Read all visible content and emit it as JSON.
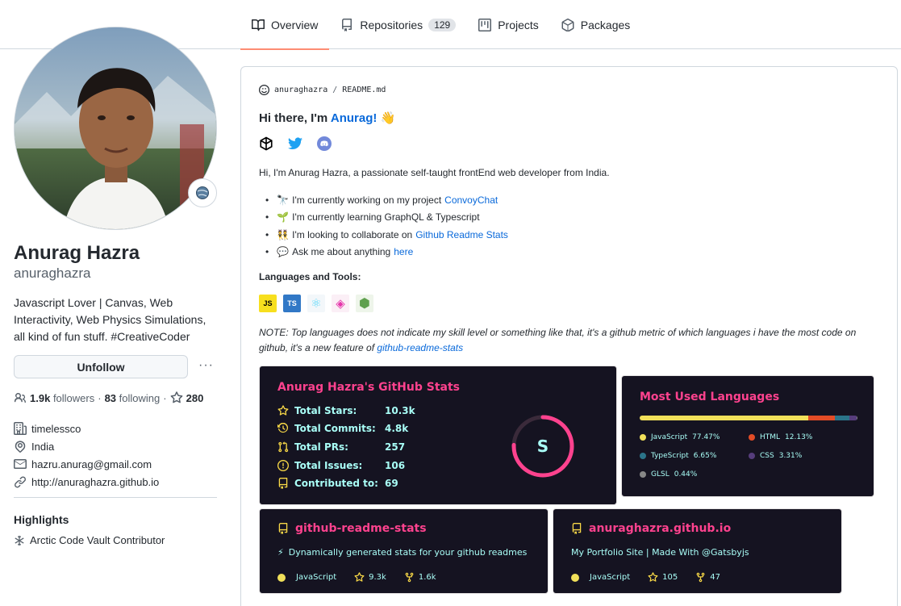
{
  "tabs": [
    {
      "label": "Overview",
      "icon": "book-icon",
      "active": true
    },
    {
      "label": "Repositories",
      "icon": "repo-icon",
      "count": "129"
    },
    {
      "label": "Projects",
      "icon": "project-icon"
    },
    {
      "label": "Packages",
      "icon": "package-icon"
    }
  ],
  "profile": {
    "name": "Anurag Hazra",
    "login": "anuraghazra",
    "bio": "Javascript Lover | Canvas, Web Interactivity, Web Physics Simulations, all kind of fun stuff. #CreativeCoder",
    "unfollow_label": "Unfollow",
    "more_label": "···",
    "followers_count": "1.9k",
    "followers_label": "followers",
    "following_count": "83",
    "following_label": "following",
    "stars_count": "280",
    "company": "timelessco",
    "location": "India",
    "email": "hazru.anurag@gmail.com",
    "website": "http://anuraghazra.github.io",
    "highlights_title": "Highlights",
    "highlight": "Arctic Code Vault Contributor"
  },
  "readme": {
    "owner": "anuraghazra",
    "separator": "/",
    "file": "README.md",
    "hi_prefix": "Hi there, I'm ",
    "hi_name": "Anurag!",
    "hi_emoji": "👋",
    "intro": "Hi, I'm Anurag Hazra, a passionate self-taught frontEnd web developer from India.",
    "bullets": [
      {
        "emoji": "🔭",
        "text": "I'm currently working on my project",
        "link": "ConvoyChat"
      },
      {
        "emoji": "🌱",
        "text": "I'm currently learning GraphQL & Typescript",
        "link": ""
      },
      {
        "emoji": "👯",
        "text": "I'm looking to collaborate on",
        "link": "Github Readme Stats"
      },
      {
        "emoji": "💬",
        "text": "Ask me about anything",
        "link": "here"
      }
    ],
    "languages_title": "Languages and Tools:",
    "tools": [
      "JS",
      "TS",
      "⚛",
      "◈",
      "⬢"
    ],
    "note_text": "NOTE: Top languages does not indicate my skill level or something like that, it's a github metric of which languages i have the most code on github, it's a new feature of ",
    "note_link": "github-readme-stats"
  },
  "stats_card": {
    "title": "Anurag Hazra's GitHub Stats",
    "rows": [
      {
        "label": "Total Stars:",
        "value": "10.3k",
        "icon": "star-icon"
      },
      {
        "label": "Total Commits:",
        "value": "4.8k",
        "icon": "history-icon"
      },
      {
        "label": "Total PRs:",
        "value": "257",
        "icon": "pull-request-icon"
      },
      {
        "label": "Total Issues:",
        "value": "106",
        "icon": "issue-icon"
      },
      {
        "label": "Contributed to:",
        "value": "69",
        "icon": "repo-icon"
      }
    ],
    "rank": "S",
    "colors": {
      "title": "#fe428e",
      "text": "#a9fef7",
      "icon": "#f8d847",
      "bg": "#151321"
    }
  },
  "langs_card": {
    "title": "Most Used Languages",
    "languages": [
      {
        "name": "JavaScript",
        "percent": "77.47%",
        "value": 77.47,
        "color": "#f1e05a"
      },
      {
        "name": "HTML",
        "percent": "12.13%",
        "value": 12.13,
        "color": "#e34c26"
      },
      {
        "name": "TypeScript",
        "percent": "6.65%",
        "value": 6.65,
        "color": "#2b7489"
      },
      {
        "name": "CSS",
        "percent": "3.31%",
        "value": 3.31,
        "color": "#563d7c"
      },
      {
        "name": "GLSL",
        "percent": "0.44%",
        "value": 0.44,
        "color": "#878787"
      }
    ]
  },
  "repos": [
    {
      "name": "github-readme-stats",
      "desc_emoji": "⚡",
      "description": "Dynamically generated stats for your github readmes",
      "language": "JavaScript",
      "stars": "9.3k",
      "forks": "1.6k"
    },
    {
      "name": "anuraghazra.github.io",
      "desc_emoji": "",
      "description": "My Portfolio Site | Made With @Gatsbyjs",
      "language": "JavaScript",
      "stars": "105",
      "forks": "47"
    }
  ]
}
